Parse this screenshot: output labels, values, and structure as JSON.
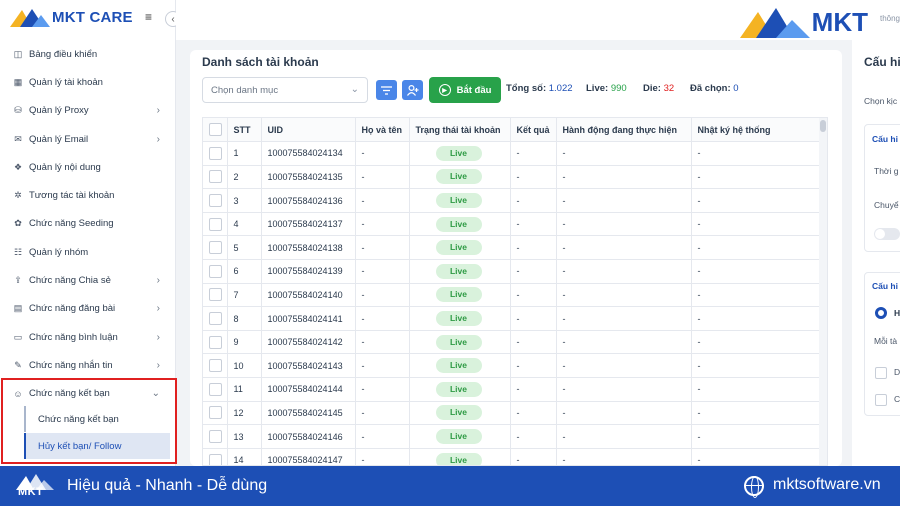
{
  "brand": {
    "name": "MKT CARE",
    "top_logo": "MKT",
    "top_logo_suffix": "thông"
  },
  "sidebar": {
    "items": [
      {
        "label": "Bảng điều khiển",
        "icon": "dashboard-icon",
        "chevron": false
      },
      {
        "label": "Quản lý tài khoản",
        "icon": "grid-icon",
        "chevron": false
      },
      {
        "label": "Quản lý Proxy",
        "icon": "proxy-icon",
        "chevron": true
      },
      {
        "label": "Quản lý Email",
        "icon": "email-icon",
        "chevron": true
      },
      {
        "label": "Quản lý nội dung",
        "icon": "content-icon",
        "chevron": false
      },
      {
        "label": "Tương tác tài khoản",
        "icon": "interact-icon",
        "chevron": false
      },
      {
        "label": "Chức năng Seeding",
        "icon": "seeding-icon",
        "chevron": false
      },
      {
        "label": "Quản lý nhóm",
        "icon": "group-icon",
        "chevron": false
      },
      {
        "label": "Chức năng Chia sẻ",
        "icon": "share-icon",
        "chevron": true
      },
      {
        "label": "Chức năng đăng bài",
        "icon": "post-icon",
        "chevron": true
      },
      {
        "label": "Chức năng bình luận",
        "icon": "comment-icon",
        "chevron": true
      },
      {
        "label": "Chức năng nhắn tin",
        "icon": "message-icon",
        "chevron": true
      },
      {
        "label": "Chức năng kết bạn",
        "icon": "add-friend-icon",
        "chevron": true,
        "expanded": true
      }
    ],
    "submenu": [
      {
        "label": "Chức năng kết bạn",
        "active": false
      },
      {
        "label": "Hủy kết bạn/ Follow",
        "active": true
      }
    ]
  },
  "main": {
    "title": "Danh sách tài khoản",
    "select_placeholder": "Chọn danh mục",
    "start_label": "Bắt đầu",
    "stats": {
      "total_label": "Tổng số:",
      "total": "1.022",
      "live_label": "Live:",
      "live": "990",
      "die_label": "Die:",
      "die": "32",
      "selected_label": "Đã chọn:",
      "selected": "0"
    },
    "colors": {
      "total": "#1d4fb5",
      "live": "#28a24a",
      "die": "#e02020",
      "selected": "#1d4fb5"
    },
    "columns": [
      "STT",
      "UID",
      "Họ và tên",
      "Trạng thái tài khoản",
      "Kết quả",
      "Hành động đang thực hiện",
      "Nhật ký hệ thống"
    ],
    "rows": [
      {
        "stt": "1",
        "uid": "100075584024134",
        "name": "-",
        "status": "Live",
        "result": "-",
        "action": "-",
        "log": "-"
      },
      {
        "stt": "2",
        "uid": "100075584024135",
        "name": "-",
        "status": "Live",
        "result": "-",
        "action": "-",
        "log": "-"
      },
      {
        "stt": "3",
        "uid": "100075584024136",
        "name": "-",
        "status": "Live",
        "result": "-",
        "action": "-",
        "log": "-"
      },
      {
        "stt": "4",
        "uid": "100075584024137",
        "name": "-",
        "status": "Live",
        "result": "-",
        "action": "-",
        "log": "-"
      },
      {
        "stt": "5",
        "uid": "100075584024138",
        "name": "-",
        "status": "Live",
        "result": "-",
        "action": "-",
        "log": "-"
      },
      {
        "stt": "6",
        "uid": "100075584024139",
        "name": "-",
        "status": "Live",
        "result": "-",
        "action": "-",
        "log": "-"
      },
      {
        "stt": "7",
        "uid": "100075584024140",
        "name": "-",
        "status": "Live",
        "result": "-",
        "action": "-",
        "log": "-"
      },
      {
        "stt": "8",
        "uid": "100075584024141",
        "name": "-",
        "status": "Live",
        "result": "-",
        "action": "-",
        "log": "-"
      },
      {
        "stt": "9",
        "uid": "100075584024142",
        "name": "-",
        "status": "Live",
        "result": "-",
        "action": "-",
        "log": "-"
      },
      {
        "stt": "10",
        "uid": "100075584024143",
        "name": "-",
        "status": "Live",
        "result": "-",
        "action": "-",
        "log": "-"
      },
      {
        "stt": "11",
        "uid": "100075584024144",
        "name": "-",
        "status": "Live",
        "result": "-",
        "action": "-",
        "log": "-"
      },
      {
        "stt": "12",
        "uid": "100075584024145",
        "name": "-",
        "status": "Live",
        "result": "-",
        "action": "-",
        "log": "-"
      },
      {
        "stt": "13",
        "uid": "100075584024146",
        "name": "-",
        "status": "Live",
        "result": "-",
        "action": "-",
        "log": "-"
      },
      {
        "stt": "14",
        "uid": "100075584024147",
        "name": "-",
        "status": "Live",
        "result": "-",
        "action": "-",
        "log": "-"
      }
    ]
  },
  "right_panel": {
    "title": "Cấu hi",
    "choose_label": "Chọn kịc",
    "box1_head": "Cấu hi",
    "box1_line1": "Thời g",
    "box1_line2": "Chuyể",
    "box2_head": "Cấu hi",
    "box2_radio": "H",
    "box2_line": "Mỗi tà",
    "check1": "D",
    "check2": "C"
  },
  "banner": {
    "logo_text": "MKT",
    "tagline": "Hiệu quả - Nhanh - Dễ dùng",
    "website": "mktsoftware.vn",
    "color": "#1d4fb5"
  }
}
